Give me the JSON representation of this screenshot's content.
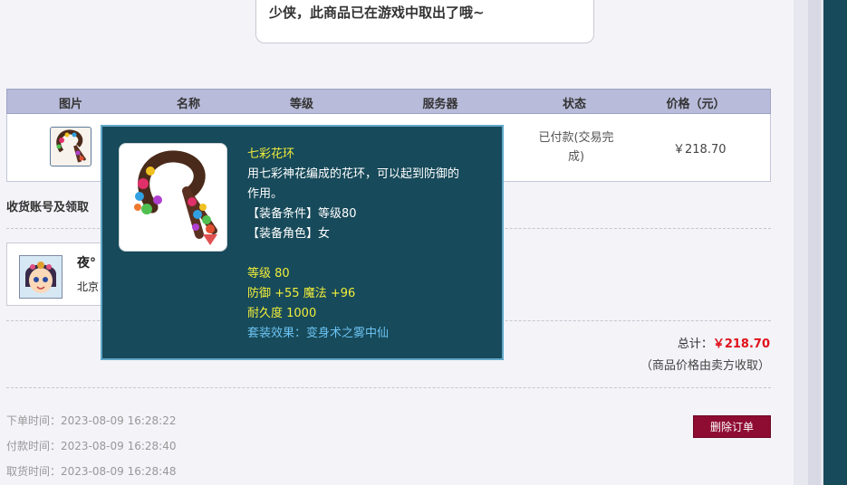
{
  "notice": "少侠，此商品已在游戏中取出了哦~",
  "table": {
    "headers": [
      "图片",
      "名称",
      "等级",
      "服务器",
      "状态",
      "价格（元）"
    ],
    "row": {
      "status": "已付款(交易完成)",
      "price": "￥218.70"
    }
  },
  "receive_section": {
    "title": "收货账号及领取"
  },
  "buyer": {
    "name": "夜°",
    "server": "北京"
  },
  "summary": {
    "total_label": "总计：",
    "total_value": "￥218.70",
    "note": "（商品价格由卖方收取）"
  },
  "times": [
    {
      "label": "下单时间：",
      "value": "2023-08-09 16:28:22"
    },
    {
      "label": "付款时间：",
      "value": "2023-08-09 16:28:40"
    },
    {
      "label": "取货时间：",
      "value": "2023-08-09 16:28:48"
    }
  ],
  "actions": {
    "delete_order": "删除订单"
  },
  "tooltip": {
    "item_name": "七彩花环",
    "desc_line1": "用七彩神花编成的花环，可以起到防御的",
    "desc_line2": "作用。",
    "equip_level": "【装备条件】等级80",
    "equip_role": "【装备角色】女",
    "level": "等级 80",
    "stats": "防御 +55 魔法 +96",
    "durability": "耐久度 1000",
    "set_effect": "套装效果：变身术之雾中仙"
  },
  "colors": {
    "tooltip_bg": "#174a5a",
    "tooltip_border": "#5fa7c8",
    "item_name": "#f2ee3a",
    "set_effect": "#6cc3f2",
    "total_amount": "#e0101a",
    "delete_button": "#8e0b32",
    "table_header": "#b8bbd9"
  }
}
